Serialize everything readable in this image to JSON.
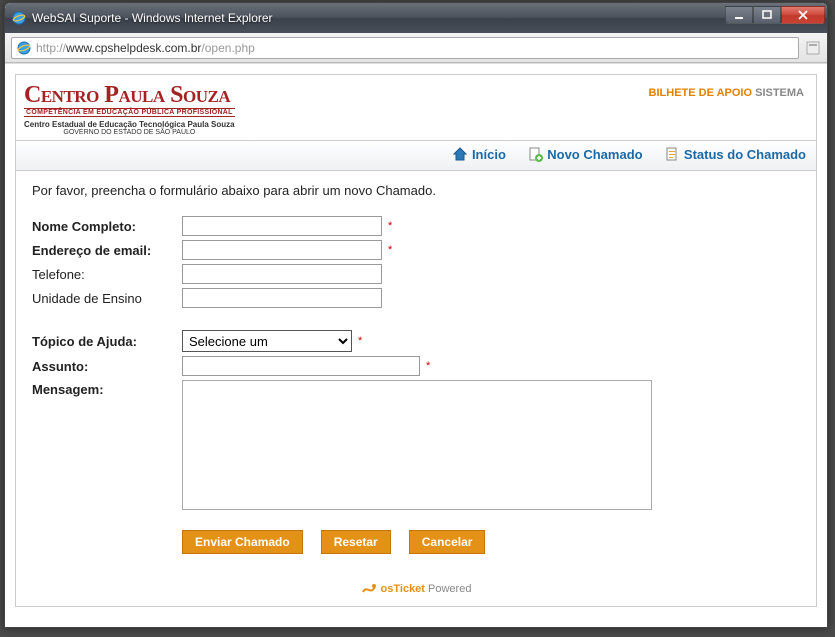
{
  "window": {
    "title": "WebSAI Suporte - Windows Internet Explorer",
    "url_prefix": "http://",
    "url_host": "www.cpshelpdesk.com.br",
    "url_path": "/open.php"
  },
  "header": {
    "logo_line1a": "Centro ",
    "logo_line1b": "Paula Souza",
    "logo_sub1": "COMPETÊNCIA EM EDUCAÇÃO PÚBLICA PROFISSIONAL",
    "logo_sub2": "Centro Estadual de Educação Tecnológica Paula Souza",
    "logo_sub3": "GOVERNO DO ESTADO DE SÃO PAULO",
    "right_orange": "BILHETE DE APOIO",
    "right_gray": " SISTEMA"
  },
  "nav": {
    "home": "Início",
    "new": "Novo Chamado",
    "status": "Status do Chamado"
  },
  "form": {
    "intro": "Por favor, preencha o formulário abaixo para abrir um novo Chamado.",
    "labels": {
      "nome": "Nome Completo:",
      "email": "Endereço de email:",
      "telefone": "Telefone:",
      "unidade": "Unidade de Ensino",
      "topico": "Tópico de Ajuda:",
      "assunto": "Assunto:",
      "mensagem": "Mensagem:"
    },
    "values": {
      "nome": "",
      "email": "",
      "telefone": "",
      "unidade": "",
      "topico_selected": "Selecione um",
      "assunto": "",
      "mensagem": ""
    },
    "required_mark": "*"
  },
  "buttons": {
    "submit": "Enviar Chamado",
    "reset": "Resetar",
    "cancel": "Cancelar"
  },
  "footer": {
    "brand": "osTicket",
    "powered": " Powered"
  }
}
